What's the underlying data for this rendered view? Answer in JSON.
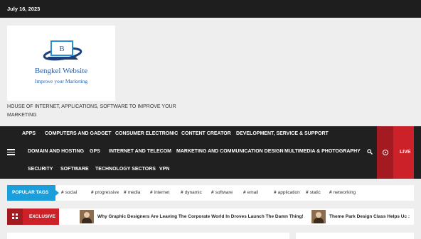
{
  "topbar": {
    "date": "July 16, 2023"
  },
  "logo": {
    "name": "Bengkel Website",
    "tagline": "Improve your Marketing",
    "letter": "B"
  },
  "site_description": "HOUSE OF INTERNET, APPLICATIONS, SOFTWARE TO IMPROVE YOUR MARKETING",
  "nav": {
    "row1": [
      "APPS",
      "COMPUTERS AND GADGET",
      "CONSUMER ELECTRONIC",
      "CONTENT CREATOR",
      "DEVELOPMENT, SERVICE & SUPPORT"
    ],
    "row2": [
      "DOMAIN AND HOSTING",
      "GPS",
      "INTERNET AND TELECOM",
      "MARKETING AND COMMUNICATION DESIGN",
      "MULTIMEDIA & PHOTOGRAPHY"
    ],
    "row3": [
      "SECURITY",
      "SOFTWARE",
      "TECHNOLOGY SECTORS",
      "VPN"
    ],
    "live_label": "LIVE",
    "icons": {
      "menu": "hamburger-icon",
      "search": "search-icon",
      "live": "live-icon"
    }
  },
  "popular_tags": {
    "label": "POPULAR TAGS",
    "tags": [
      "social",
      "progressive",
      "media",
      "internet",
      "dynamic",
      "software",
      "email",
      "application",
      "static",
      "networking"
    ]
  },
  "exclusive": {
    "label": "EXCLUSIVE",
    "items": [
      "Why Graphic Designers Are Leaving The Corporate World In Droves  Launch The Damn Thing!",
      "Theme Park Design Class Helps Uc :"
    ]
  },
  "colors": {
    "accent_red": "#cc2129",
    "accent_blue": "#1a9fdc",
    "dark": "#202020"
  }
}
